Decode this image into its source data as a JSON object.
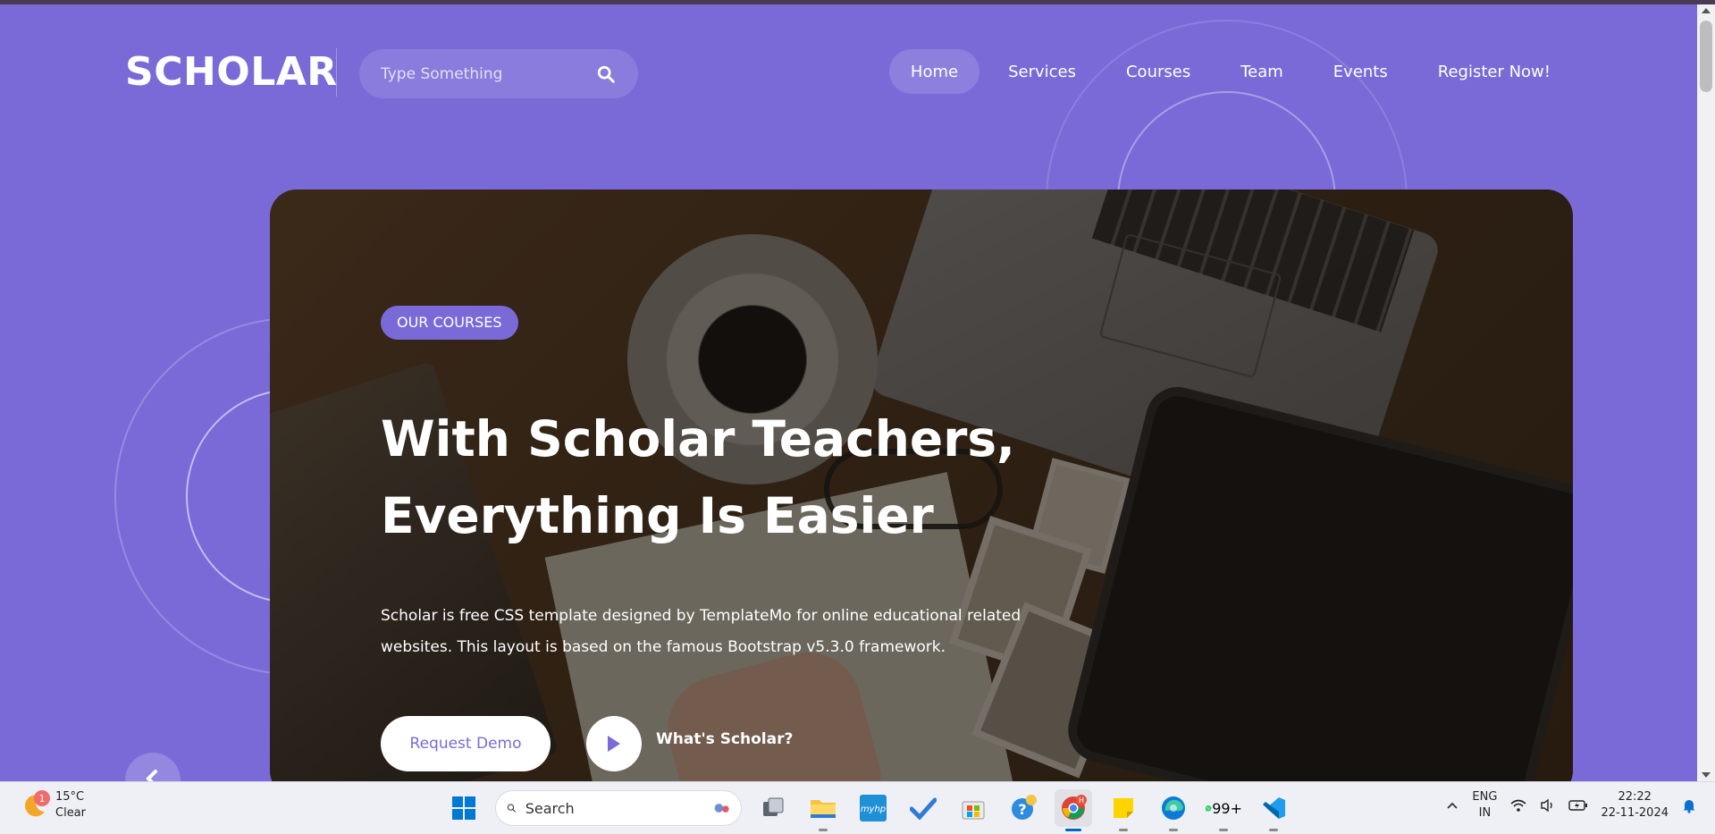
{
  "site": {
    "logo": "SCHOLAR",
    "search": {
      "placeholder": "Type Something"
    },
    "nav": [
      {
        "label": "Home",
        "active": true
      },
      {
        "label": "Services",
        "active": false
      },
      {
        "label": "Courses",
        "active": false
      },
      {
        "label": "Team",
        "active": false
      },
      {
        "label": "Events",
        "active": false
      },
      {
        "label": "Register Now!",
        "active": false
      }
    ]
  },
  "hero": {
    "badge": "OUR COURSES",
    "title_line1": "With Scholar Teachers,",
    "title_line2": "Everything Is Easier",
    "description": "Scholar is free CSS template designed by TemplateMo for online educational related websites. This layout is based on the famous Bootstrap v5.3.0 framework.",
    "primary_button": "Request Demo",
    "secondary_label": "What's Scholar?"
  },
  "colors": {
    "accent": "#7a6ad8",
    "white": "#ffffff",
    "taskbar": "#eef0f6"
  },
  "taskbar": {
    "weather": {
      "temp": "15°C",
      "condition": "Clear",
      "badge": "1"
    },
    "search_placeholder": "Search",
    "apps": [
      {
        "name": "task-view-icon"
      },
      {
        "name": "file-explorer-icon"
      },
      {
        "name": "myhp-icon",
        "label": "myhp"
      },
      {
        "name": "todo-icon"
      },
      {
        "name": "microsoft-store-icon"
      },
      {
        "name": "help-icon"
      },
      {
        "name": "chrome-icon",
        "active": true
      },
      {
        "name": "sticky-notes-icon"
      },
      {
        "name": "edge-icon"
      },
      {
        "name": "whatsapp-icon",
        "badge": "99+"
      },
      {
        "name": "vscode-icon"
      }
    ],
    "language": {
      "line1": "ENG",
      "line2": "IN"
    },
    "clock": {
      "time": "22:22",
      "date": "22-11-2024"
    }
  }
}
